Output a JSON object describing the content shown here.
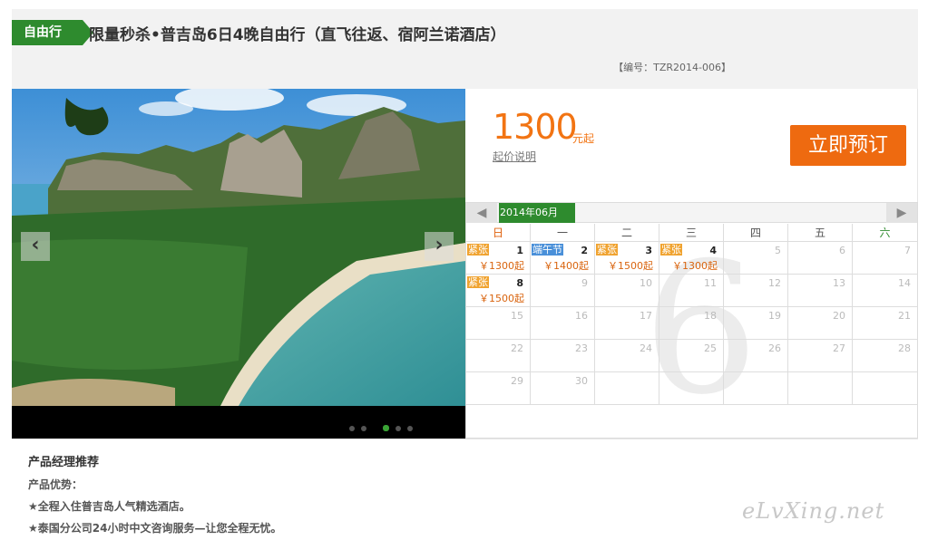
{
  "header": {
    "tag": "自由行",
    "title": "限量秒杀•普吉岛6日4晚自由行（直飞往返、宿阿兰诺酒店）",
    "code": "【编号：TZR2014-006】"
  },
  "slider": {
    "prev_icon": "‹",
    "next_icon": "›",
    "dot_count": 5,
    "active_dot": 3
  },
  "price": {
    "amount": "1300",
    "unit": "元起",
    "note": "起价说明",
    "book_label": "立即预订",
    "accent": "#f27413"
  },
  "calendar": {
    "month_label": "2014年06月",
    "prev_icon": "◀",
    "next_icon": "▶",
    "big_month": "6",
    "weekdays": [
      "日",
      "一",
      "二",
      "三",
      "四",
      "五",
      "六"
    ],
    "weeks": [
      [
        {
          "day": "1",
          "badge": "紧张",
          "badge_color": "orange",
          "price": "￥1300起"
        },
        {
          "day": "2",
          "badge": "端午节",
          "badge_color": "blue",
          "price": "￥1400起"
        },
        {
          "day": "3",
          "badge": "紧张",
          "badge_color": "orange",
          "price": "￥1500起"
        },
        {
          "day": "4",
          "badge": "紧张",
          "badge_color": "orange",
          "price": "￥1300起"
        },
        {
          "day": "5"
        },
        {
          "day": "6"
        },
        {
          "day": "7"
        }
      ],
      [
        {
          "day": "8",
          "badge": "紧张",
          "badge_color": "orange",
          "price": "￥1500起"
        },
        {
          "day": "9"
        },
        {
          "day": "10"
        },
        {
          "day": "11"
        },
        {
          "day": "12"
        },
        {
          "day": "13"
        },
        {
          "day": "14"
        }
      ],
      [
        {
          "day": "15"
        },
        {
          "day": "16"
        },
        {
          "day": "17"
        },
        {
          "day": "18"
        },
        {
          "day": "19"
        },
        {
          "day": "20"
        },
        {
          "day": "21"
        }
      ],
      [
        {
          "day": "22"
        },
        {
          "day": "23"
        },
        {
          "day": "24"
        },
        {
          "day": "25"
        },
        {
          "day": "26"
        },
        {
          "day": "27"
        },
        {
          "day": "28"
        }
      ],
      [
        {
          "day": "29"
        },
        {
          "day": "30"
        },
        {
          "day": ""
        },
        {
          "day": ""
        },
        {
          "day": ""
        },
        {
          "day": ""
        },
        {
          "day": ""
        }
      ]
    ]
  },
  "details": {
    "section_title": "产品经理推荐",
    "advantages_title": "产品优势：",
    "advantages": [
      "★全程入住普吉岛人气精选酒店。",
      "★泰国分公司24小时中文咨询服务—让您全程无忧。"
    ]
  },
  "watermark": "eLvXing.net"
}
